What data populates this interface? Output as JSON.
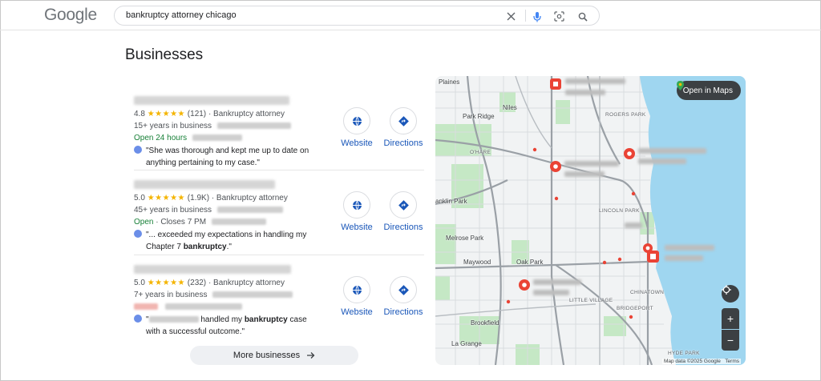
{
  "header": {
    "logo": "Google",
    "search_query": "bankruptcy attorney chicago",
    "icons": [
      "close-icon",
      "mic-icon",
      "lens-icon",
      "search-icon"
    ]
  },
  "section_title": "Businesses",
  "listings": [
    {
      "rating": "4.8",
      "stars": "★★★★★",
      "reviews": "(121)",
      "category": "· Bankruptcy attorney",
      "years": "15+ years in business",
      "status": "Open 24 hours",
      "review_pre": "\"She was thorough and kept me up to date on",
      "review_post": "anything pertaining to my case.\"",
      "website_label": "Website",
      "directions_label": "Directions"
    },
    {
      "rating": "5.0",
      "stars": "★★★★★",
      "reviews": "(1.9K)",
      "category": "· Bankruptcy attorney",
      "years": "45+ years in business",
      "status_open": "Open",
      "status_rest": "· Closes 7 PM",
      "review_pre": "\"... exceeded my expectations in handling my",
      "review_post_plain": "Chapter 7 ",
      "review_post_bold": "bankruptcy",
      "review_post_end": ".\"",
      "website_label": "Website",
      "directions_label": "Directions"
    },
    {
      "rating": "5.0",
      "stars": "★★★★★",
      "reviews": "(232)",
      "category": "· Bankruptcy attorney",
      "years": "7+ years in business",
      "review_mid": "handled my ",
      "review_bold": "bankruptcy",
      "review_tail": " case",
      "review_post": "with a successful outcome.\"",
      "website_label": "Website",
      "directions_label": "Directions"
    }
  ],
  "more_businesses": "More businesses",
  "map": {
    "open_in_maps": "Open in Maps",
    "zoom_in": "+",
    "zoom_out": "−",
    "attribution": "Map data ©2025 Google",
    "terms": "Terms",
    "labels": {
      "plaines": "Plaines",
      "park_ridge": "Park Ridge",
      "niles": "Niles",
      "ohare": "O'HARE",
      "rogers_park": "ROGERS PARK",
      "franklin_park": "anklin Park",
      "lincoln_park": "LINCOLN PARK",
      "melrose_park": "Melrose Park",
      "maywood": "Maywood",
      "oak_park": "Oak Park",
      "chinatown": "CHINATOWN",
      "little_village": "LITTLE VILLAGE",
      "bridgeport": "BRIDGEPORT",
      "brookfield": "Brookfield",
      "la_grange": "La Grange",
      "hyde_park": "HYDE PARK"
    },
    "colors": {
      "water": "#9fd6f0",
      "park": "#c5e8c5",
      "pin": "#ea4335"
    }
  }
}
